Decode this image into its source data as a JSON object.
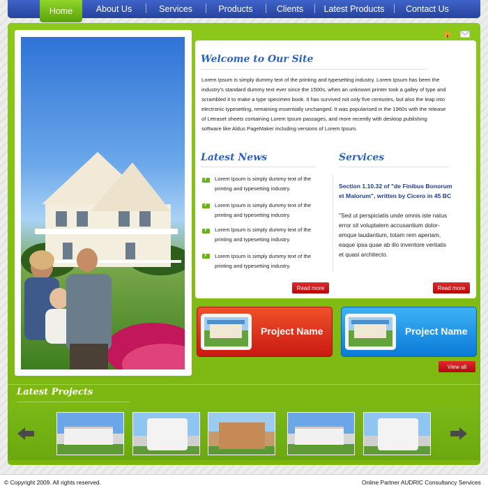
{
  "nav": {
    "items": [
      {
        "label": "Home"
      },
      {
        "label": "About Us"
      },
      {
        "label": "Services"
      },
      {
        "label": "Products"
      },
      {
        "label": "Clients"
      },
      {
        "label": "Latest Products"
      },
      {
        "label": "Contact Us"
      }
    ],
    "active": "Home"
  },
  "top_icons": [
    "home-icon",
    "mail-icon"
  ],
  "welcome": {
    "title": "Welcome to Our Site",
    "lines": [
      "Lorem Ipsum is simply dummy text of the printing and typesetting industry. Lorem Ipsum has been the",
      "industry's standard dummy text ever since the 1500s, when an unknown printer took a galley of type and",
      "scrambled it to make a type specimen book. It has survived not only five centuries, but also the leap into",
      "electronic typesetting, remaining essentially unchanged. It was popularised in the 1960s with the release",
      "of Letraset sheets containing Lorem Ipsum passages, and more recently with desktop publishing",
      "software like Aldus PageMaker including versions of Lorem Ipsum."
    ]
  },
  "news": {
    "title": "Latest News",
    "items": [
      {
        "line1": "Lorem Ipsum is simply dummy text of the",
        "line2": "printing and typesetting industry."
      },
      {
        "line1": "Lorem Ipsum is simply dummy text of the",
        "line2": "printing and typesetting industry."
      },
      {
        "line1": "Lorem Ipsum is simply dummy text of the",
        "line2": "printing and typesetting industry."
      },
      {
        "line1": "Lorem Ipsum is simply dummy text of the",
        "line2": "printing and typesetting industry."
      }
    ],
    "read_more": "Read more"
  },
  "services": {
    "title": "Services",
    "subtitle_lines": [
      "Section 1.10.32 of \"de Finibus Bonorum",
      "et Malorum\", written by Cicero in 45 BC"
    ],
    "body_lines": [
      "\"Sed ut perspiciatis unde omnis iste natus",
      "error sit voluptatem accusantium dolor-",
      "emque laudantium, totam rem aperiam,",
      "eaque ipsa quae ab illo inventore veritatis",
      "et quasi architecto."
    ],
    "read_more": "Read more"
  },
  "projects": [
    {
      "name": "Project Name",
      "color": "#d8201a"
    },
    {
      "name": "Project Name",
      "color": "#1a90e6"
    }
  ],
  "view_all": "View all",
  "latest_projects": {
    "title": "Latest Projects"
  },
  "footer": {
    "left": "© Copyright 2009. All rights reserved.",
    "right": "Online Partner AUDRIC Consultancy Services"
  },
  "colors": {
    "nav_blue": "#2f52b8",
    "green": "#84c016",
    "accent_blue": "#2a63bf",
    "red": "#c8121a"
  }
}
